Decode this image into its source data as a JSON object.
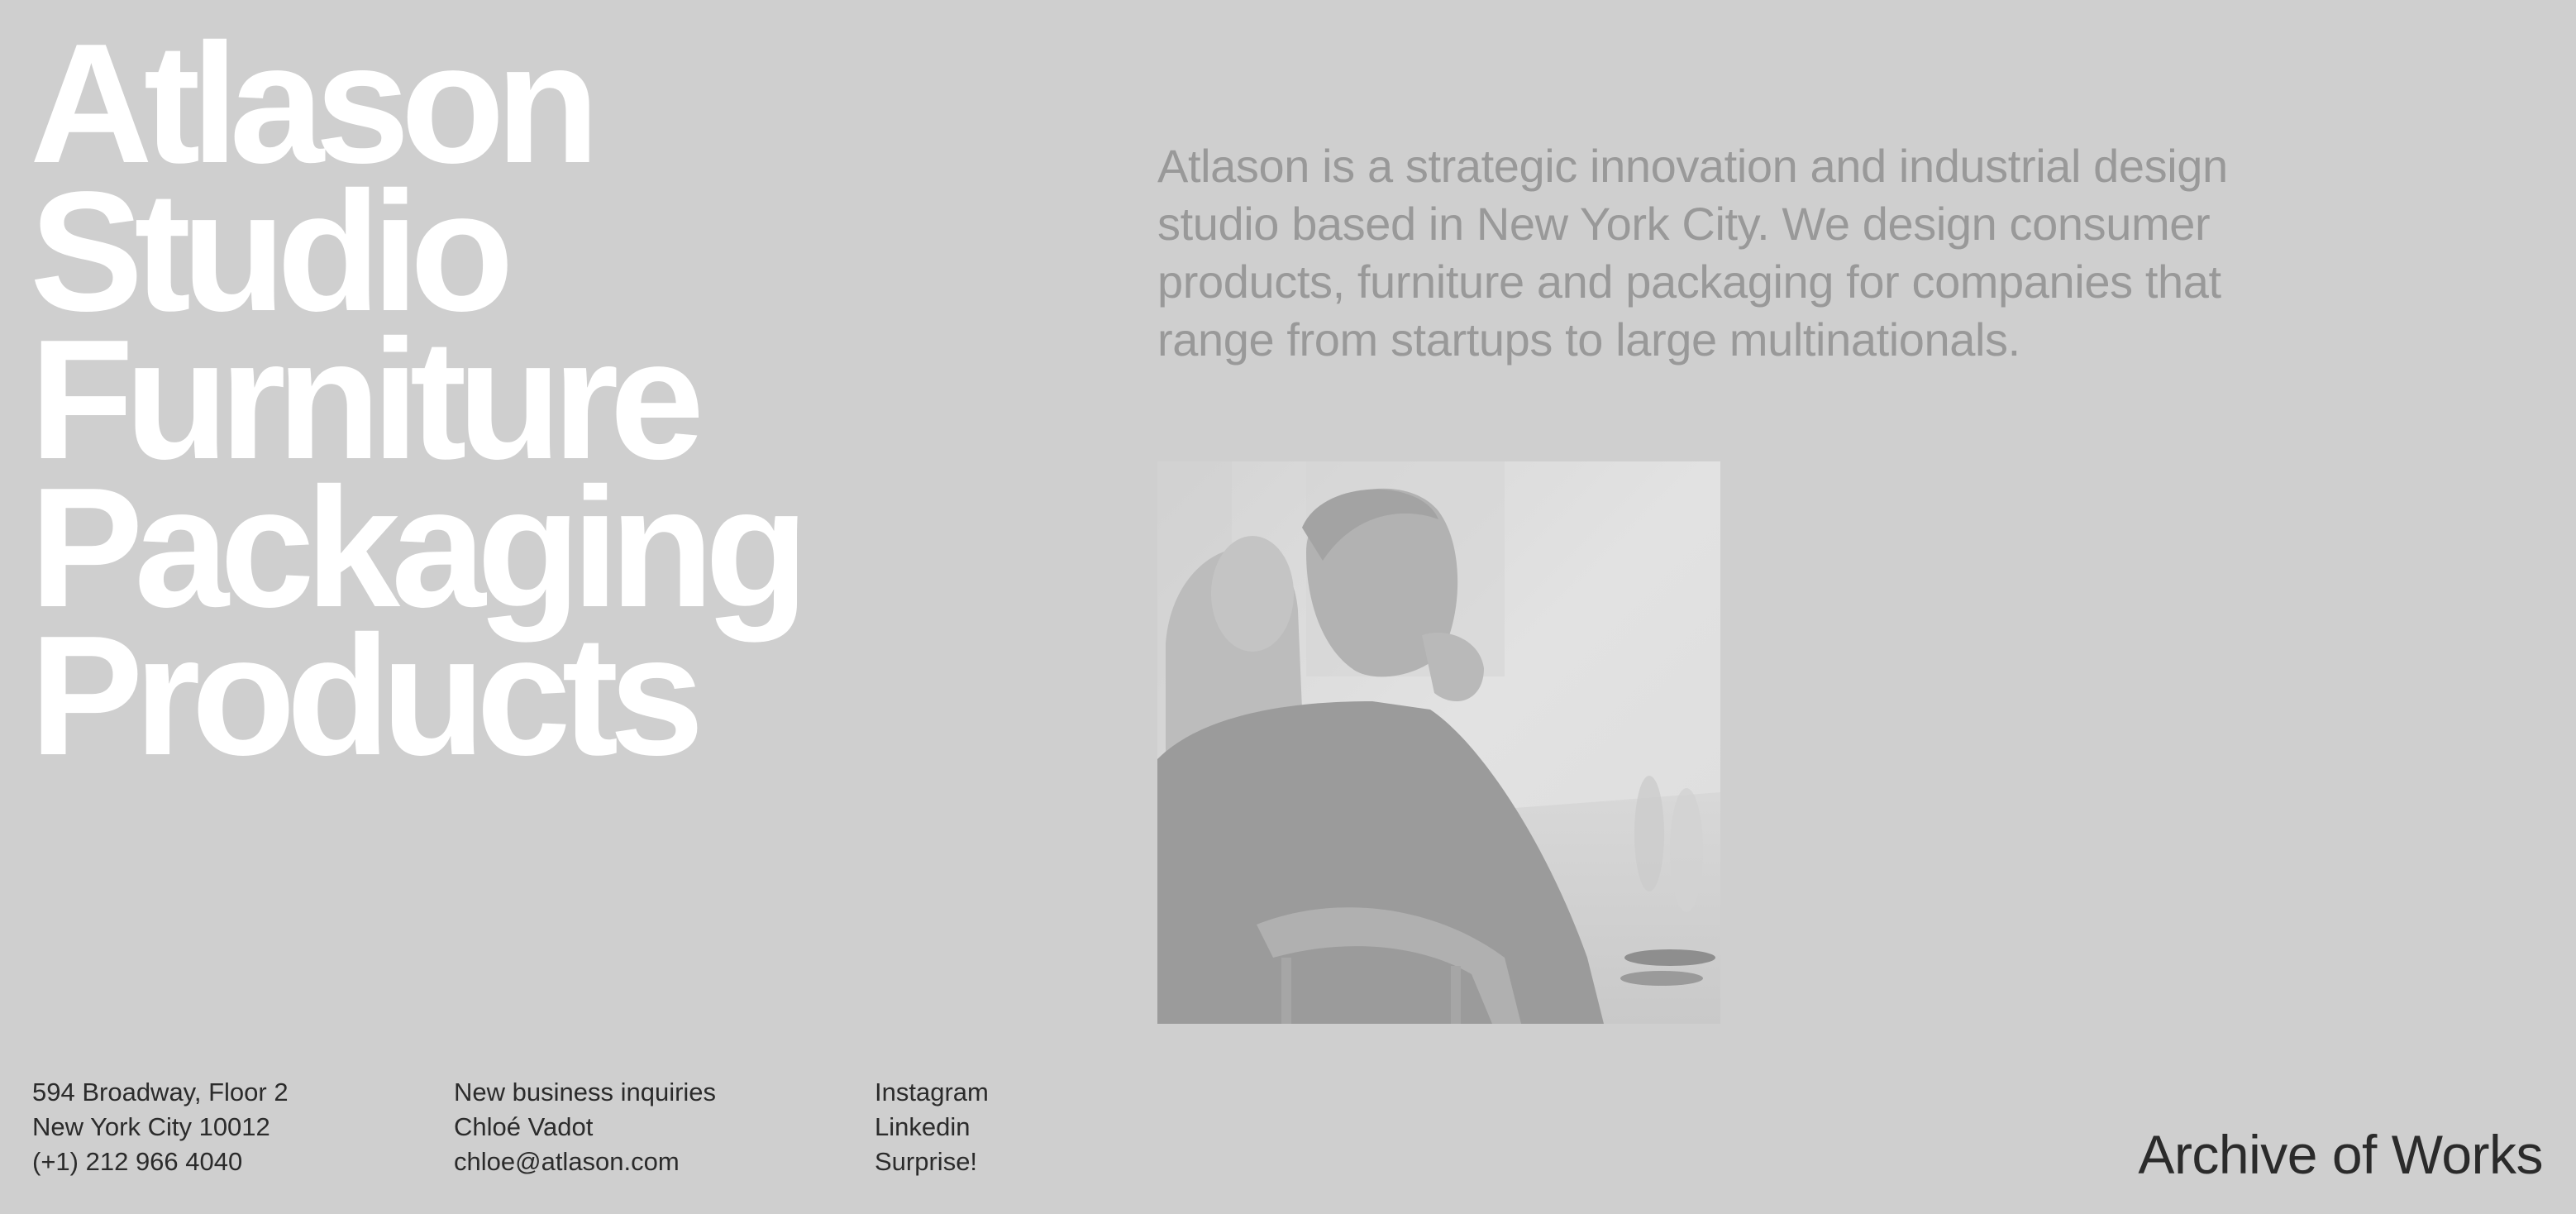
{
  "nav": {
    "items": [
      {
        "label": "Atlason"
      },
      {
        "label": "Studio"
      },
      {
        "label": "Furniture"
      },
      {
        "label": "Packaging"
      },
      {
        "label": "Products"
      }
    ]
  },
  "intro": {
    "text": "Atlason is a strategic innovation and industrial design studio based in New York City. We design consumer products, furniture and packaging for companies that range from startups to large multinationals."
  },
  "footer": {
    "address": {
      "street": "594 Broadway, Floor 2",
      "city": "New York City 10012",
      "phone": "(+1) 212 966 4040"
    },
    "inquiries": {
      "heading": "New business inquiries",
      "name": "Chloé Vadot",
      "email": "chloe@atlason.com"
    },
    "social": {
      "instagram": "Instagram",
      "linkedin": "Linkedin",
      "surprise": "Surprise!"
    },
    "archive_label": "Archive of Works"
  },
  "colors": {
    "background": "#cfcfcf",
    "headline": "#ffffff",
    "intro_text": "#999999",
    "footer_text": "#2b2b2b"
  }
}
